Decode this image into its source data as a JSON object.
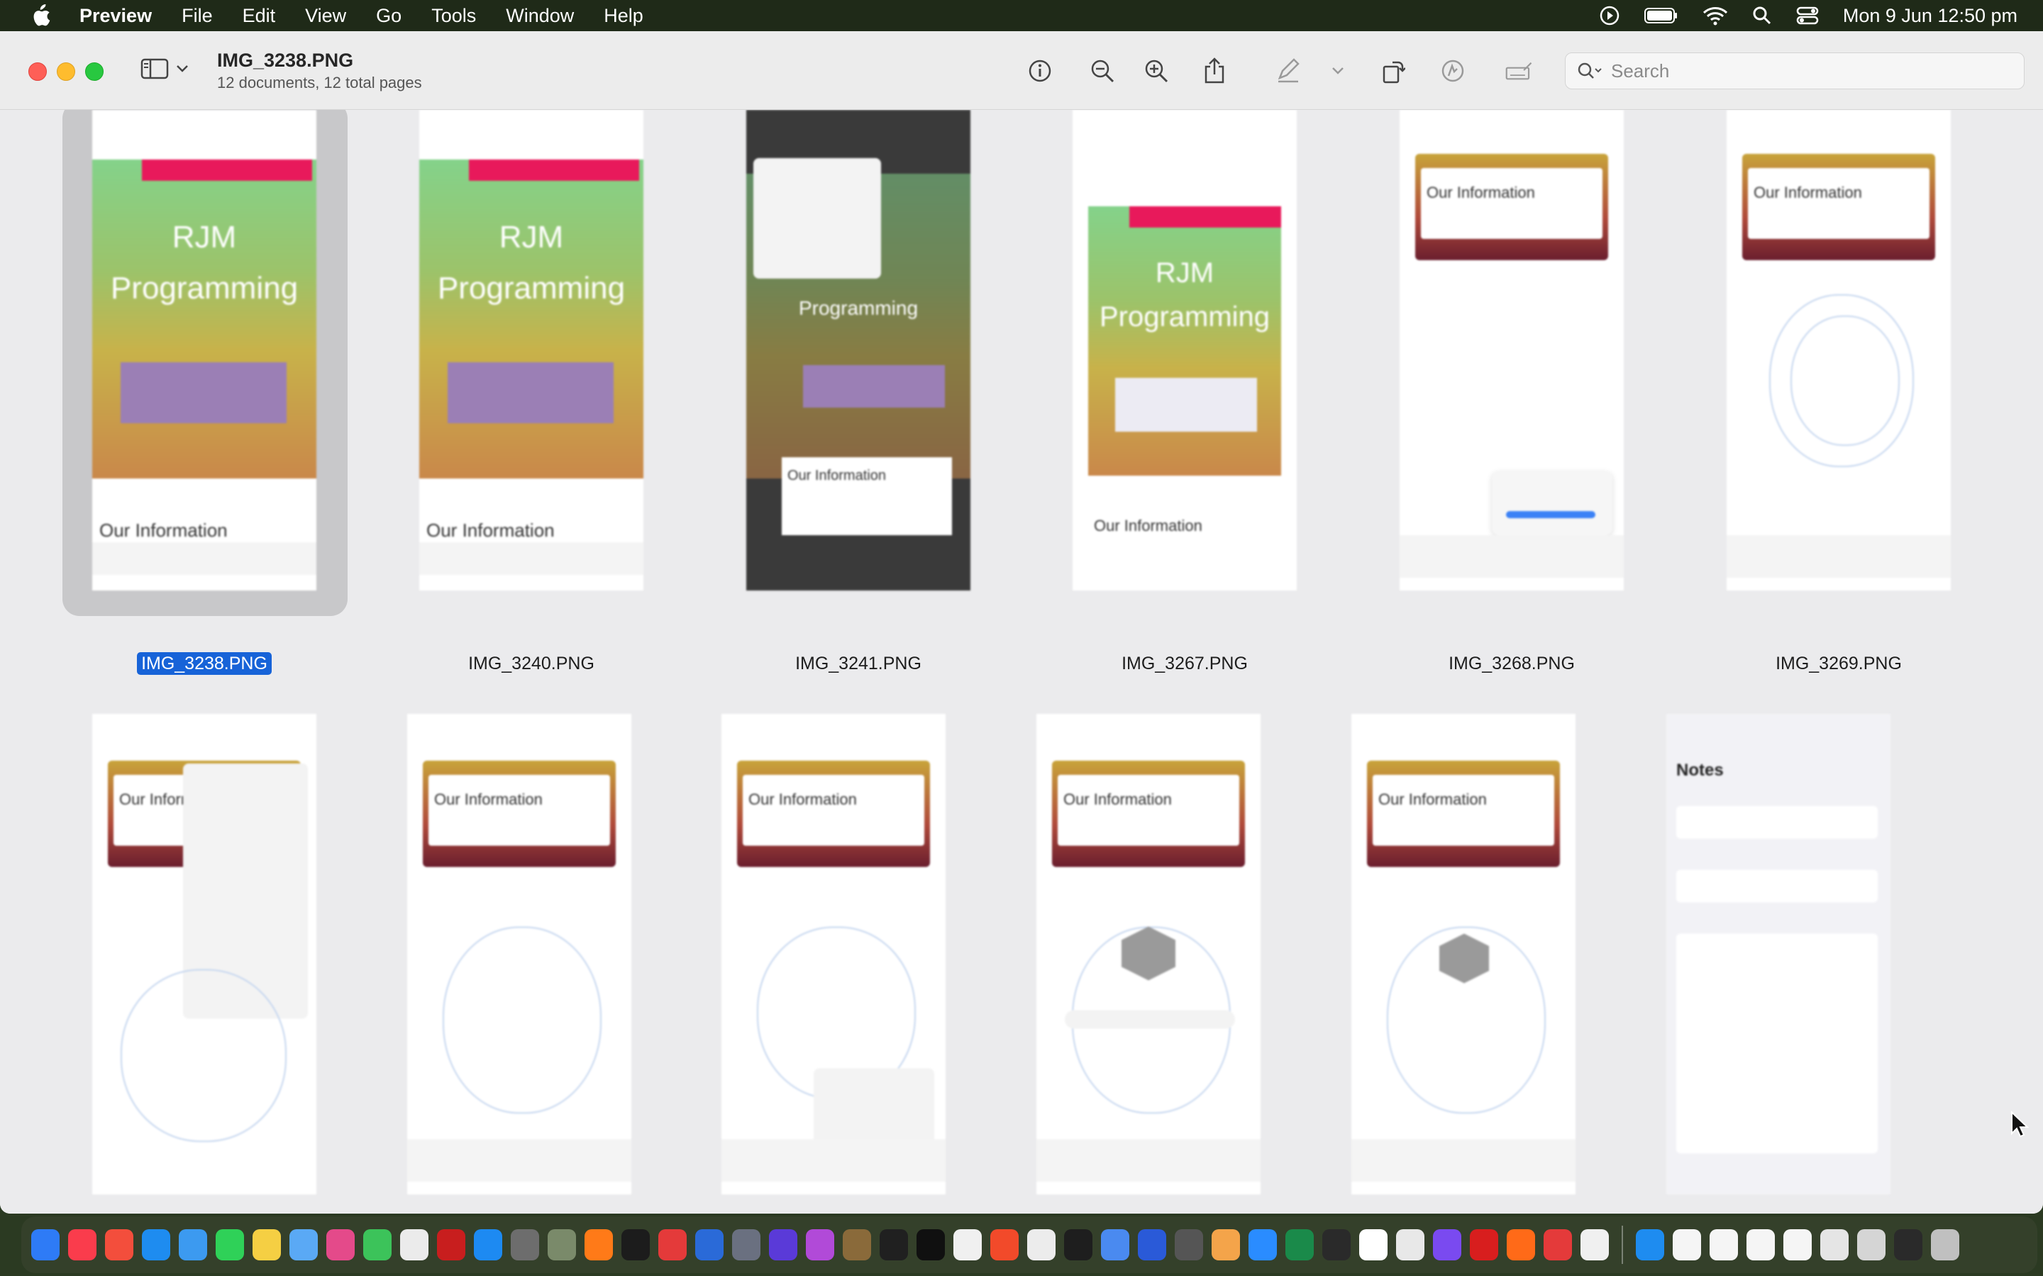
{
  "menubar": {
    "app_name": "Preview",
    "items": [
      "File",
      "Edit",
      "View",
      "Go",
      "Tools",
      "Window",
      "Help"
    ],
    "clock": "Mon 9 Jun  12:50 pm"
  },
  "toolbar": {
    "title": "IMG_3238.PNG",
    "subtitle": "12 documents, 12 total pages",
    "search_placeholder": "Search"
  },
  "thumbnails": [
    {
      "label": "IMG_3238.PNG",
      "selected": true
    },
    {
      "label": "IMG_3240.PNG",
      "selected": false
    },
    {
      "label": "IMG_3241.PNG",
      "selected": false
    },
    {
      "label": "IMG_3267.PNG",
      "selected": false
    },
    {
      "label": "IMG_3268.PNG",
      "selected": false
    },
    {
      "label": "IMG_3269.PNG",
      "selected": false
    }
  ],
  "thumb_text": {
    "brand_line1": "RJM",
    "brand_line2": "Programming",
    "our_information": "Our Information",
    "notes_title": "Notes"
  },
  "colors": {
    "selection": "#1763d8",
    "close": "#fe5f57",
    "minimize": "#febc2e",
    "zoom": "#28c840"
  },
  "dock": {
    "app_colors": [
      "#2e7bf6",
      "#fa3c4c",
      "#f34e3c",
      "#1e8cf0",
      "#3c9af0",
      "#2fd158",
      "#f5cf43",
      "#5aa9f5",
      "#e44a8a",
      "#3cc35a",
      "#ebebeb",
      "#c81e1e",
      "#1d8af2",
      "#6d6d6d",
      "#7a8a6a",
      "#ff7a18",
      "#1c1c1c",
      "#e43a3a",
      "#2a6ad8",
      "#6a7080",
      "#5a3ad8",
      "#b14ad8",
      "#8a6a3a",
      "#202020",
      "#101010",
      "#f0f0f0",
      "#f24a2a",
      "#ececec",
      "#1e1e1e",
      "#4a8af0",
      "#2a5ad8",
      "#555555",
      "#f4a44a",
      "#2a8cff",
      "#1a8a4a",
      "#2a2a2a",
      "#ffffff",
      "#e8e8e8",
      "#7a4af0",
      "#d81e1e",
      "#ff6a18",
      "#e43a3a",
      "#f0f0f0",
      "#1e8cf0",
      "#f5f5f5",
      "#f5f5f5",
      "#f5f5f5",
      "#f5f5f5",
      "#e5e5e5",
      "#d5d5d5",
      "#2a2a2a",
      "#c0c0c0"
    ]
  }
}
